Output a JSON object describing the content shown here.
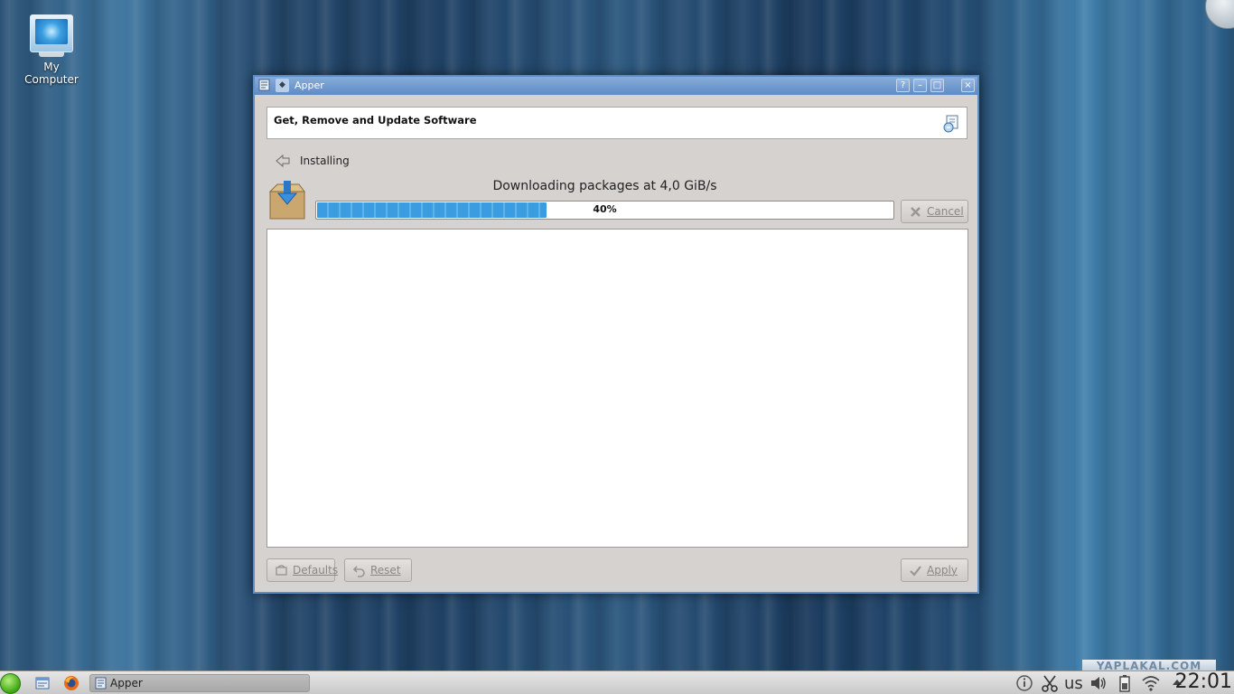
{
  "desktop": {
    "icon_label": "My Computer",
    "watermark": "YAPLAKAL.COM"
  },
  "window": {
    "title": "Apper",
    "buttons": {
      "help": "?",
      "minimize": "–",
      "maximize": "□",
      "close": "×"
    }
  },
  "header": {
    "title": "Get, Remove and Update Software"
  },
  "nav": {
    "back_label": "Installing"
  },
  "transaction": {
    "status": "Downloading packages at 4,0 GiB/s",
    "progress_label": "40%",
    "progress_fraction": 0.4,
    "cancel_label": "Cancel"
  },
  "footer": {
    "defaults_label": "Defaults",
    "reset_label": "Reset",
    "apply_label": "Apply"
  },
  "taskbar": {
    "task_label": "Apper",
    "keyboard_layout": "us",
    "clock": "22:01"
  },
  "colors": {
    "accent": "#5e8cc4",
    "progress": "#3b9de0"
  }
}
